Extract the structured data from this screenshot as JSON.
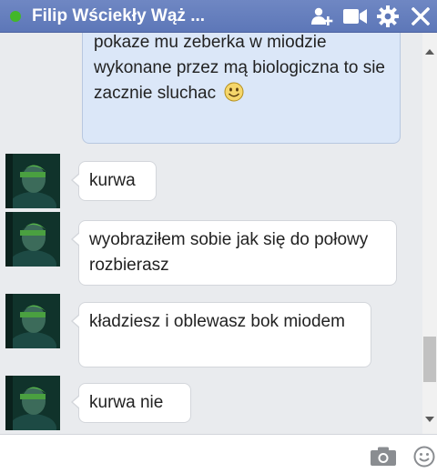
{
  "header": {
    "title": "Filip Wściekły Wąż ...",
    "status_color": "#42b72a",
    "icons": [
      "add-people-icon",
      "video-camera-icon",
      "gear-icon",
      "close-icon"
    ]
  },
  "messages": [
    {
      "sender": "me",
      "text": "pokaze mu zeberka w miodzie wykonane przez mą biologiczna to sie zacznie sluchac",
      "emoji": "smiley"
    },
    {
      "sender": "them",
      "text": "kurwa"
    },
    {
      "sender": "them",
      "text": "wyobraziłem sobie jak się do połowy rozbierasz"
    },
    {
      "sender": "them",
      "text": "kładziesz i oblewasz bok miodem"
    },
    {
      "sender": "them",
      "text": "kurwa nie"
    }
  ],
  "composer": {
    "icons": [
      "camera-icon",
      "emoji-icon"
    ]
  },
  "colors": {
    "header": "#5d77b8",
    "outgoing_bubble": "#dbe7f8",
    "incoming_bubble": "#ffffff",
    "thread_background": "#e9ebee"
  }
}
